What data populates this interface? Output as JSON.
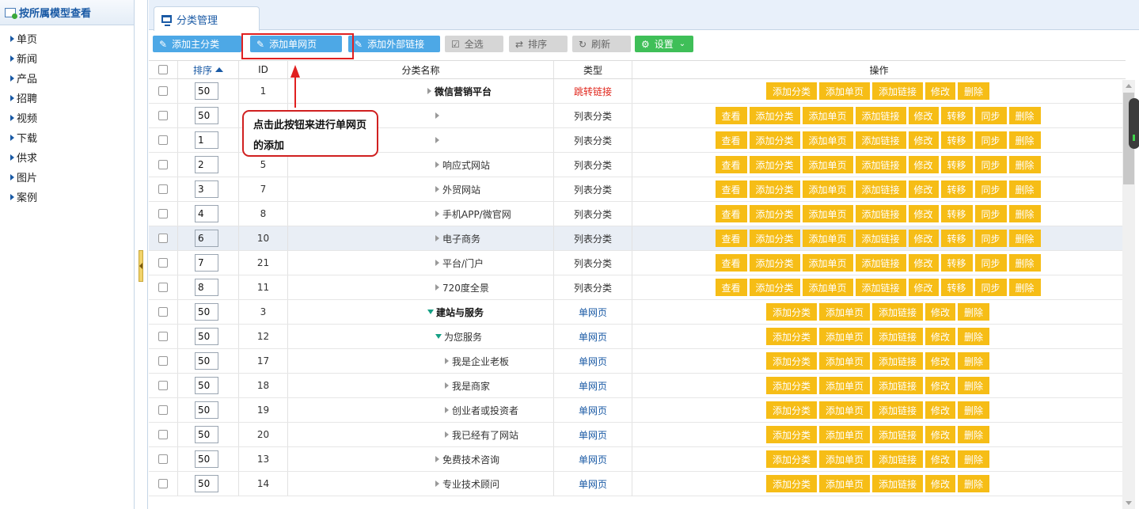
{
  "left_panel": {
    "title": "按所属模型查看",
    "items": [
      "单页",
      "新闻",
      "产品",
      "招聘",
      "视频",
      "下载",
      "供求",
      "图片",
      "案例"
    ]
  },
  "tab": {
    "label": "分类管理"
  },
  "toolbar": {
    "add_main": "添加主分类",
    "add_page": "添加单网页",
    "add_link": "添加外部链接",
    "select_all": "全选",
    "sort": "排序",
    "refresh": "刷新",
    "settings": "设置"
  },
  "table": {
    "headers": {
      "sort": "排序",
      "id": "ID",
      "name": "分类名称",
      "type": "类型",
      "ops": "操作"
    },
    "rows": [
      {
        "sort": "50",
        "id": "1",
        "name": "微信营销平台",
        "type": "跳转链接"
      },
      {
        "sort": "50",
        "id": "",
        "name": "",
        "type": "列表分类"
      },
      {
        "sort": "1",
        "id": "",
        "name": "",
        "type": "列表分类"
      },
      {
        "sort": "2",
        "id": "5",
        "name": "响应式网站",
        "type": "列表分类"
      },
      {
        "sort": "3",
        "id": "7",
        "name": "外贸网站",
        "type": "列表分类"
      },
      {
        "sort": "4",
        "id": "8",
        "name": "手机APP/微官网",
        "type": "列表分类"
      },
      {
        "sort": "6",
        "id": "10",
        "name": "电子商务",
        "type": "列表分类"
      },
      {
        "sort": "7",
        "id": "21",
        "name": "平台/门户",
        "type": "列表分类"
      },
      {
        "sort": "8",
        "id": "11",
        "name": "720度全景",
        "type": "列表分类"
      },
      {
        "sort": "50",
        "id": "3",
        "name": "建站与服务",
        "type": "单网页"
      },
      {
        "sort": "50",
        "id": "12",
        "name": "为您服务",
        "type": "单网页"
      },
      {
        "sort": "50",
        "id": "17",
        "name": "我是企业老板",
        "type": "单网页"
      },
      {
        "sort": "50",
        "id": "18",
        "name": "我是商家",
        "type": "单网页"
      },
      {
        "sort": "50",
        "id": "19",
        "name": "创业者或投资者",
        "type": "单网页"
      },
      {
        "sort": "50",
        "id": "20",
        "name": "我已经有了网站",
        "type": "单网页"
      },
      {
        "sort": "50",
        "id": "13",
        "name": "免费技术咨询",
        "type": "单网页"
      },
      {
        "sort": "50",
        "id": "14",
        "name": "专业技术顾问",
        "type": "单网页"
      }
    ],
    "ops": {
      "view": "查看",
      "add_cat": "添加分类",
      "add_page": "添加单页",
      "add_link": "添加链接",
      "edit": "修改",
      "move": "转移",
      "sync": "同步",
      "delete": "删除"
    }
  },
  "annotation": {
    "note": "点击此按钮来进行单网页的添加"
  },
  "colors": {
    "accent": "#4da8e6",
    "op_button": "#f6bd16",
    "annotation": "#e02020"
  }
}
